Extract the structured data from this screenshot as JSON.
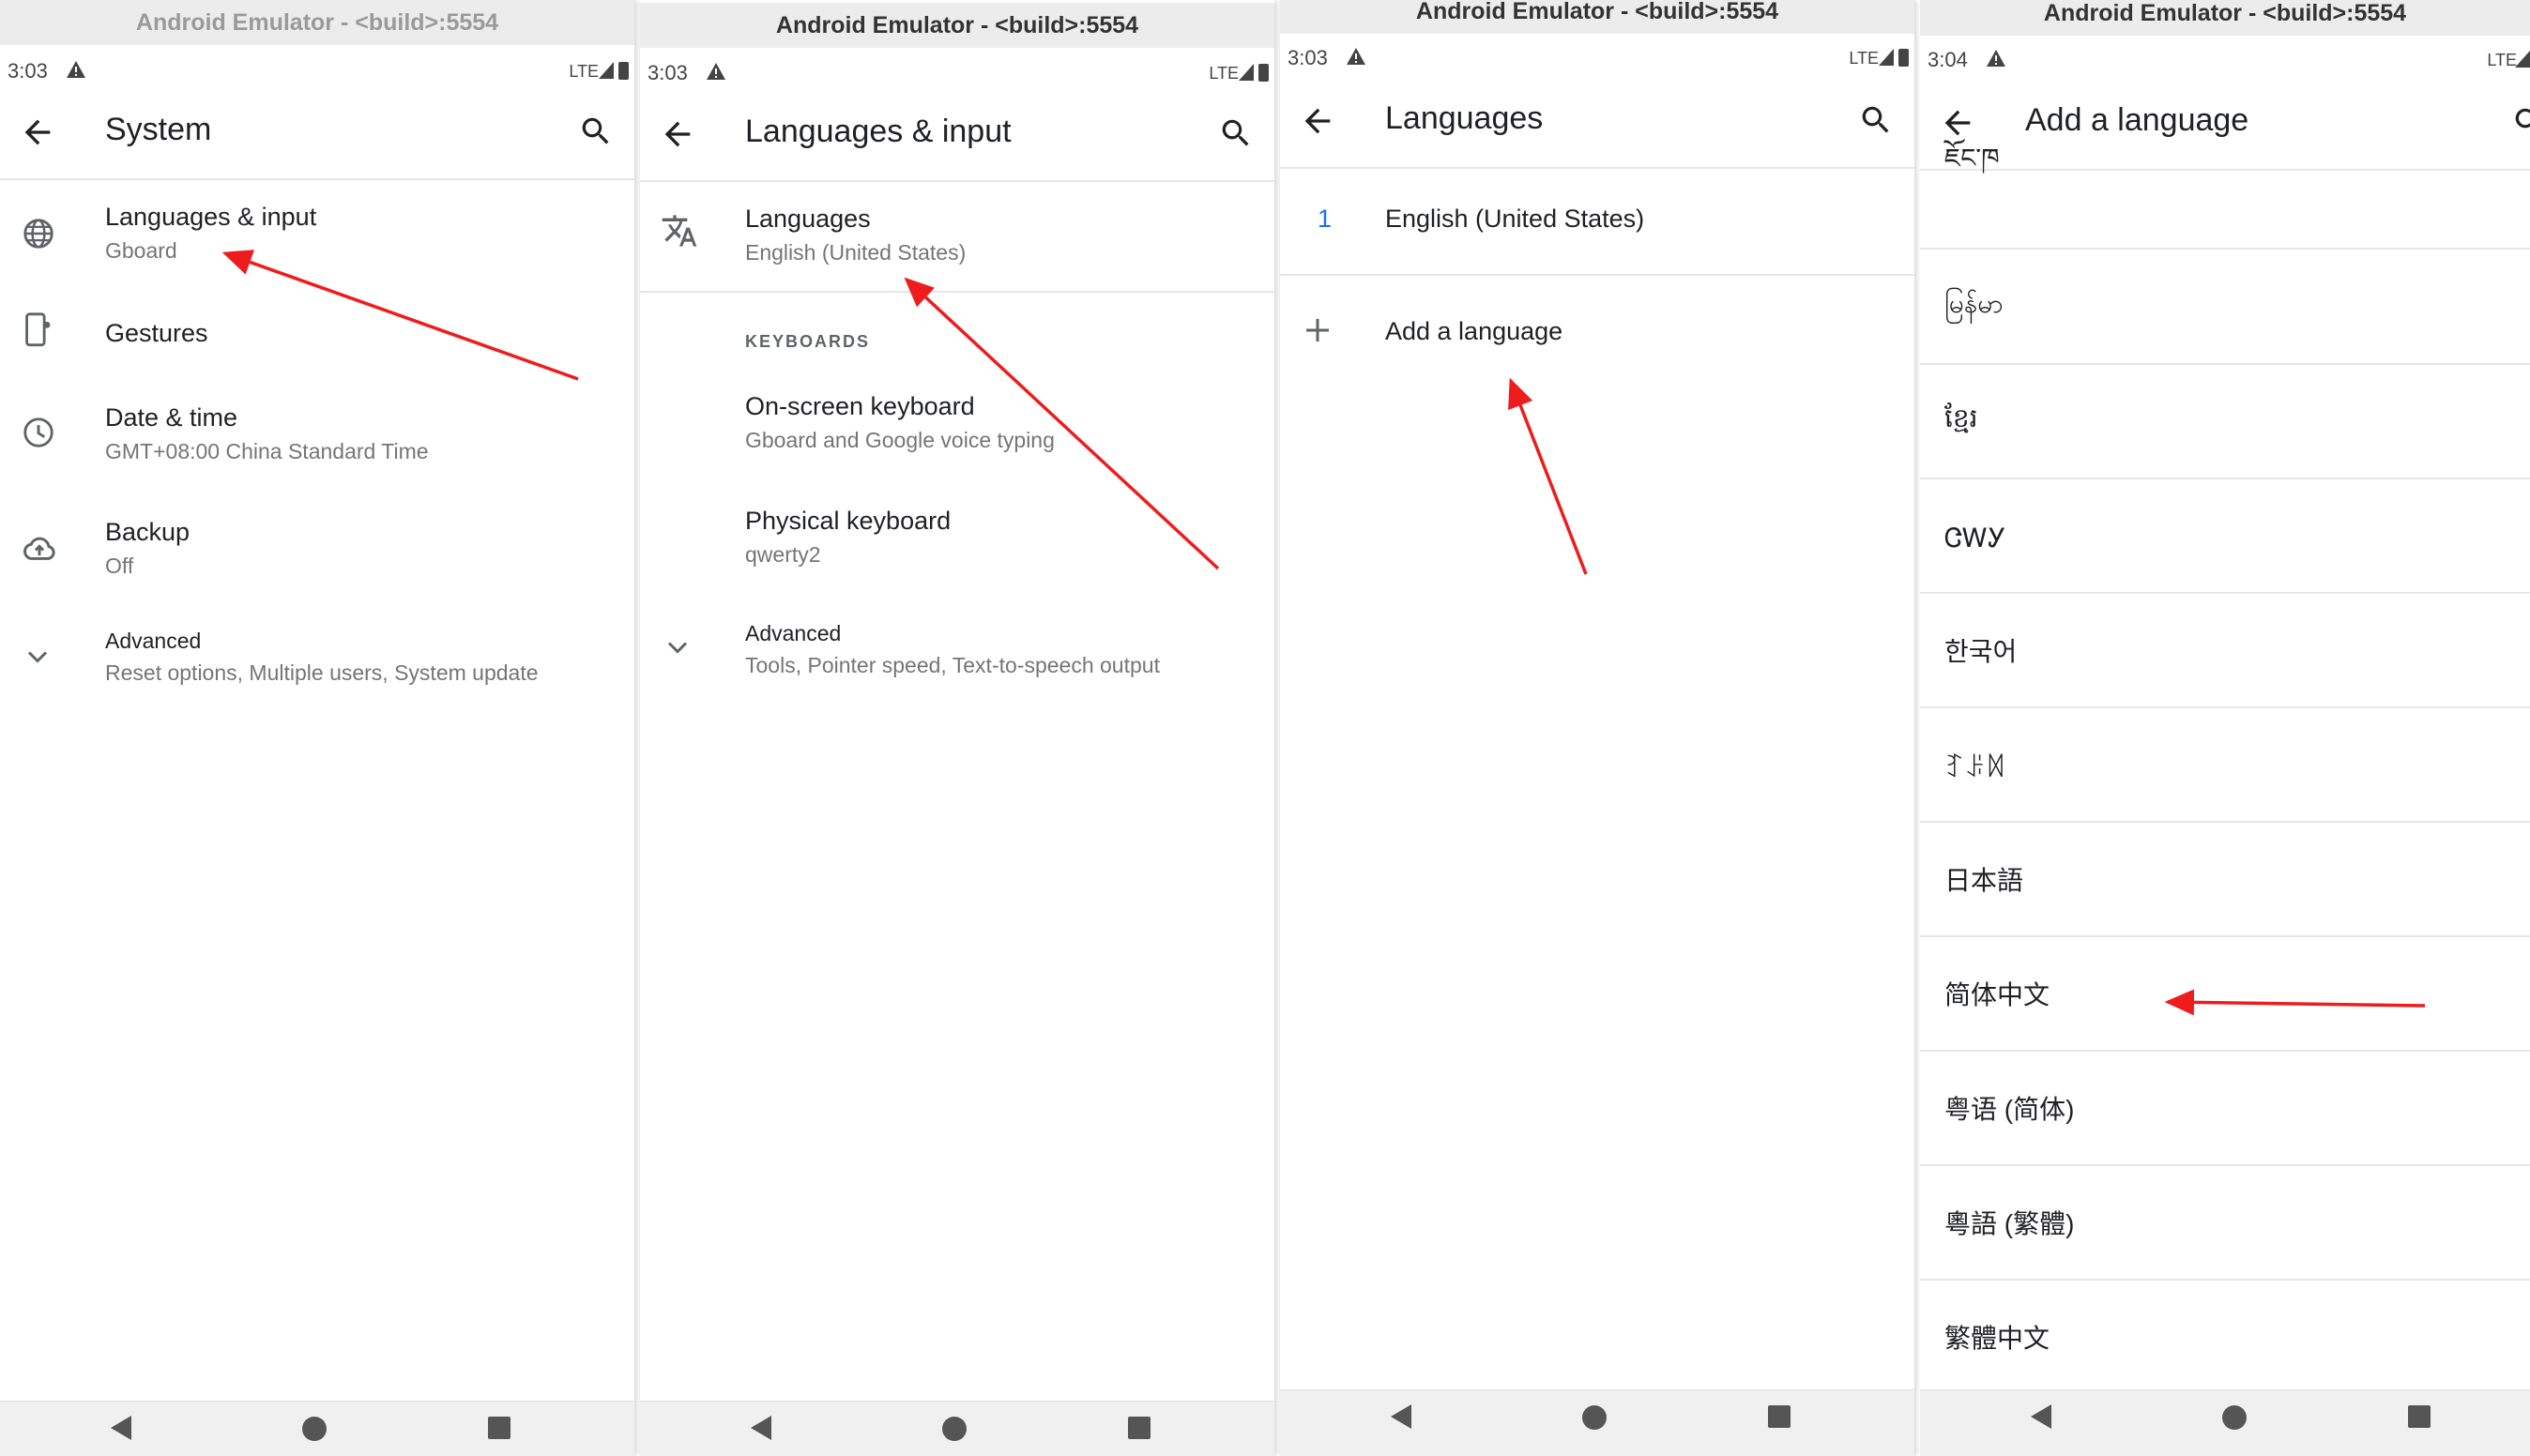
{
  "window_title": "Android Emulator - <build>:5554",
  "status": {
    "time_1": "3:03",
    "time_2": "3:03",
    "time_3": "3:03",
    "time_4": "3:04",
    "network": "LTE"
  },
  "screen1": {
    "title": "System",
    "items": [
      {
        "primary": "Languages & input",
        "secondary": "Gboard",
        "icon": "globe-icon"
      },
      {
        "primary": "Gestures",
        "secondary": "",
        "icon": "phone-gesture-icon"
      },
      {
        "primary": "Date & time",
        "secondary": "GMT+08:00 China Standard Time",
        "icon": "clock-icon"
      },
      {
        "primary": "Backup",
        "secondary": "Off",
        "icon": "cloud-upload-icon"
      },
      {
        "primary": "Advanced",
        "secondary": "Reset options, Multiple users, System update",
        "icon": "chevron-down-icon"
      }
    ]
  },
  "screen2": {
    "title": "Languages & input",
    "languages": {
      "primary": "Languages",
      "secondary": "English (United States)",
      "icon": "translate-icon"
    },
    "keyboards_header": "KEYBOARDS",
    "onscreen": {
      "primary": "On-screen keyboard",
      "secondary": "Gboard and Google voice typing"
    },
    "physical": {
      "primary": "Physical keyboard",
      "secondary": "qwerty2"
    },
    "advanced": {
      "primary": "Advanced",
      "secondary": "Tools, Pointer speed, Text-to-speech output",
      "icon": "chevron-down-icon"
    }
  },
  "screen3": {
    "title": "Languages",
    "current": {
      "index": "1",
      "name": "English (United States)"
    },
    "add": {
      "label": "Add a language",
      "icon": "plus-icon"
    }
  },
  "screen4": {
    "title": "Add a language",
    "languages": [
      "ཇོང་ཁ",
      "မြန်မာ",
      "ខ្មែរ",
      "ᏣᎳᎩ",
      "한국어",
      "ꆈꌠꉙ",
      "日本語",
      "简体中文",
      "粤语 (简体)",
      "粵語 (繁體)",
      "繁體中文"
    ]
  },
  "colors": {
    "annotation_arrow": "#ee1c1c",
    "accent": "#1a73e8"
  }
}
